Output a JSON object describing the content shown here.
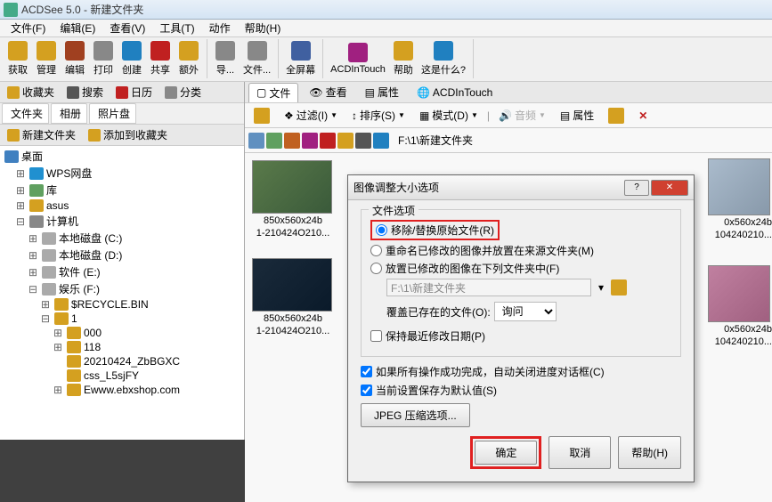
{
  "window": {
    "title": "ACDSee 5.0 - 新建文件夹"
  },
  "menu": {
    "file": "文件(F)",
    "edit": "编辑(E)",
    "view": "查看(V)",
    "tools": "工具(T)",
    "actions": "动作",
    "help": "帮助(H)"
  },
  "toolbar": {
    "acquire": "获取",
    "manage": "管理",
    "edit": "编辑",
    "print": "打印",
    "create": "创建",
    "share": "共享",
    "extra": "额外",
    "nav": "导...",
    "files": "文件...",
    "fullscreen": "全屏幕",
    "acdintouch": "ACDInTouch",
    "help": "帮助",
    "whatis": "这是什么?"
  },
  "panelTabs": {
    "fav": "收藏夹",
    "search": "搜索",
    "cal": "日历",
    "cat": "分类"
  },
  "panelTabs2": {
    "folders": "文件夹",
    "albums": "相册",
    "discs": "照片盘"
  },
  "panelActions": {
    "newFolder": "新建文件夹",
    "addFav": "添加到收藏夹"
  },
  "tree": {
    "desktop": "桌面",
    "wps": "WPS网盘",
    "lib": "库",
    "asus": "asus",
    "computer": "计算机",
    "driveC": "本地磁盘 (C:)",
    "driveD": "本地磁盘 (D:)",
    "driveE": "软件 (E:)",
    "driveF": "娱乐 (F:)",
    "recycle": "$RECYCLE.BIN",
    "one": "1",
    "f000": "000",
    "f118": "118",
    "f20210424": "20210424_ZbBGXC",
    "css": "css_L5sjFY",
    "ewww": "Ewww.ebxshop.com"
  },
  "rightTabs": {
    "files": "文件",
    "view": "查看",
    "props": "属性",
    "acd": "ACDInTouch"
  },
  "rightToolbar": {
    "filter": "过滤(I)",
    "sort": "排序(S)",
    "mode": "模式(D)",
    "audio": "音频",
    "props": "属性"
  },
  "path": "F:\\1\\新建文件夹",
  "thumbs": {
    "dim": "850x560x24b",
    "name": "1-210424O210..."
  },
  "dialog": {
    "title": "图像调整大小选项",
    "fieldset": "文件选项",
    "radio1": "移除/替换原始文件(R)",
    "radio2": "重命名已修改的图像并放置在来源文件夹(M)",
    "radio3": "放置已修改的图像在下列文件夹中(F)",
    "pathValue": "F:\\1\\新建文件夹",
    "overwrite": "覆盖已存在的文件(O):",
    "overwriteValue": "询问",
    "keepDate": "保持最近修改日期(P)",
    "autoClose": "如果所有操作成功完成，自动关闭进度对话框(C)",
    "saveDefault": "当前设置保存为默认值(S)",
    "jpegBtn": "JPEG 压缩选项...",
    "ok": "确定",
    "cancel": "取消",
    "help": "帮助(H)"
  }
}
